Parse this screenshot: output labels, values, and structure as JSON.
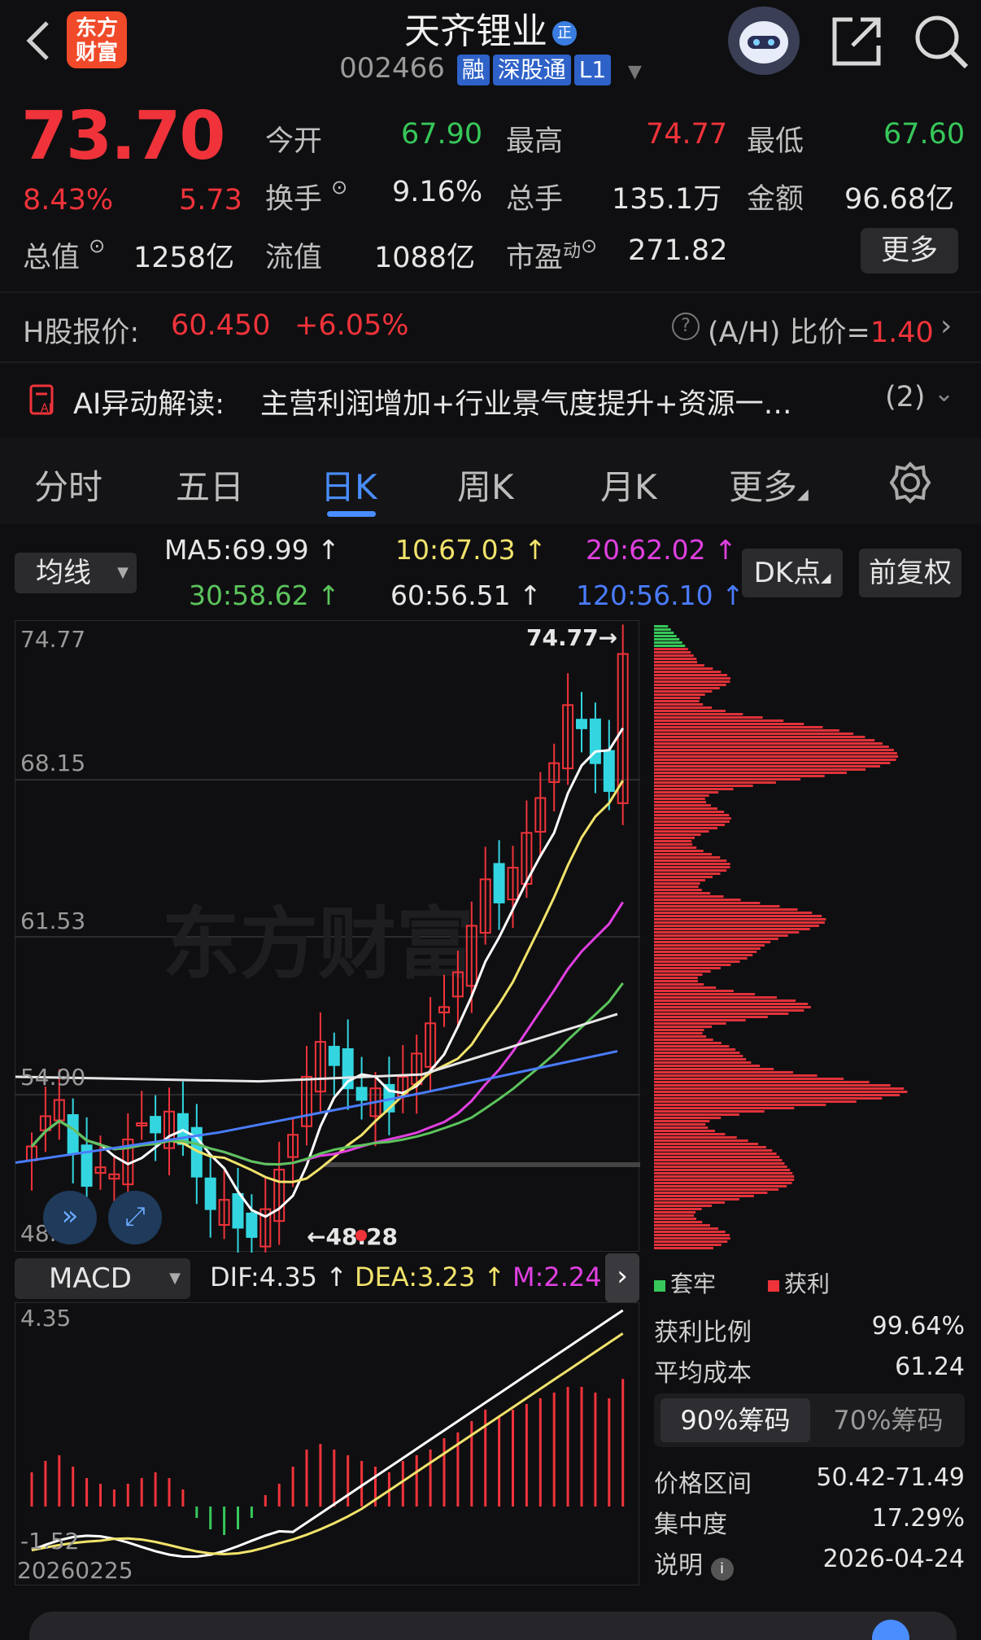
{
  "header": {
    "back_icon": "chevron-left-icon",
    "logo_text": "东方财富",
    "title": "天齐锂业",
    "title_badge": "正",
    "code": "002466",
    "tags": [
      "融",
      "深股通",
      "L1"
    ],
    "robot_icon": "robot-avatar-icon",
    "share_icon": "share-icon",
    "search_icon": "search-icon"
  },
  "quote": {
    "price": "73.70",
    "change_pct": "8.43%",
    "change_amt": "5.73",
    "open_label": "今开",
    "open": "67.90",
    "high_label": "最高",
    "high": "74.77",
    "low_label": "最低",
    "low": "67.60",
    "turnover_label": "换手",
    "turnover": "9.16%",
    "volume_label": "总手",
    "volume": "135.1万",
    "amount_label": "金额",
    "amount": "96.68亿",
    "total_cap_label": "总值",
    "total_cap": "1258亿",
    "float_cap_label": "流值",
    "float_cap": "1088亿",
    "pe_label": "市盈",
    "pe_sup": "动",
    "pe": "271.82",
    "more_label": "更多"
  },
  "hshare": {
    "label": "H股报价:",
    "price": "60.450",
    "change": "+6.05%",
    "ah_label": "(A/H) 比价=",
    "ah_value": "1.40"
  },
  "ai": {
    "label": "AI异动解读:",
    "text": "主营利润增加+行业景气度提升+资源一…",
    "count": "(2)"
  },
  "tabs": [
    "分时",
    "五日",
    "日K",
    "周K",
    "月K",
    "更多"
  ],
  "settings_icon": "gear-icon",
  "ma": {
    "selector": "均线",
    "ma5": "MA5:69.99",
    "ma10": "10:67.03",
    "ma20": "20:62.02",
    "ma30": "30:58.62",
    "ma60": "60:56.51",
    "ma120": "120:56.10",
    "dk_button": "DK点",
    "fq_button": "前复权"
  },
  "kline": {
    "y_labels": [
      "74.77",
      "68.15",
      "61.53",
      "54.90",
      "48.28"
    ],
    "max_marker": "74.77",
    "min_marker": "48.28",
    "watermark": "东方财富",
    "date_label": "20260225"
  },
  "macd": {
    "selector": "MACD",
    "dif": "DIF:4.35",
    "dea": "DEA:3.23",
    "m": "M:2.24",
    "top": "4.35",
    "bottom": "-1.52"
  },
  "chips": {
    "legend_trapped": "套牢",
    "legend_profit": "获利",
    "profit_ratio_label": "获利比例",
    "profit_ratio": "99.64%",
    "avg_cost_label": "平均成本",
    "avg_cost": "61.24",
    "tab90": "90%筹码",
    "tab70": "70%筹码",
    "range_label": "价格区间",
    "range": "50.42-71.49",
    "concentration_label": "集中度",
    "concentration": "17.29%",
    "note_label": "说明",
    "date": "2026-04-24"
  },
  "colors": {
    "up": "#f0333a",
    "down": "#33d6e0",
    "accent": "#4a8dff",
    "ma5": "#ffffff",
    "ma10": "#f1e36b",
    "ma20": "#e040e0",
    "ma30": "#5cc45c",
    "ma60": "#e6e6e6",
    "ma120": "#4a7cff"
  }
}
